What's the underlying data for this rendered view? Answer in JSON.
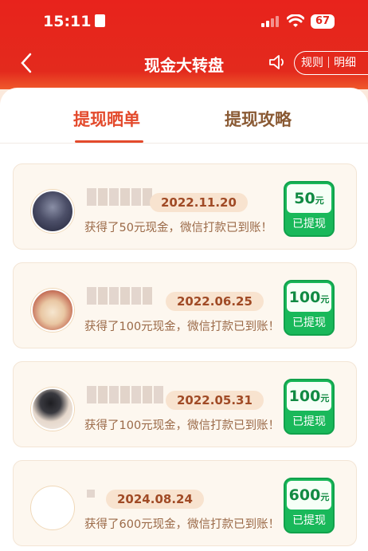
{
  "status_bar": {
    "time": "15:11",
    "battery": "67"
  },
  "header": {
    "title": "现金大转盘",
    "rules": "规则",
    "details": "明细"
  },
  "tabs": [
    {
      "label": "提现晒单",
      "active": true
    },
    {
      "label": "提现攻略",
      "active": false
    }
  ],
  "records": [
    {
      "date": "2022.11.20",
      "desc": "获得了50元现金，微信打款已到账！",
      "amount": "50",
      "unit": "元",
      "status": "已提现"
    },
    {
      "date": "2022.06.25",
      "desc": "获得了100元现金，微信打款已到账！",
      "amount": "100",
      "unit": "元",
      "status": "已提现"
    },
    {
      "date": "2022.05.31",
      "desc": "获得了100元现金，微信打款已到账！",
      "amount": "100",
      "unit": "元",
      "status": "已提现"
    },
    {
      "date": "2024.08.24",
      "desc": "获得了600元现金，微信打款已到账！",
      "amount": "600",
      "unit": "元",
      "status": "已提现"
    }
  ],
  "colors": {
    "brand_red": "#e8231c",
    "accent": "#e34a2c",
    "badge_green": "#19b85a"
  },
  "icons": [
    "back-icon",
    "sound-icon",
    "wifi-icon",
    "signal-icon",
    "battery-icon"
  ]
}
